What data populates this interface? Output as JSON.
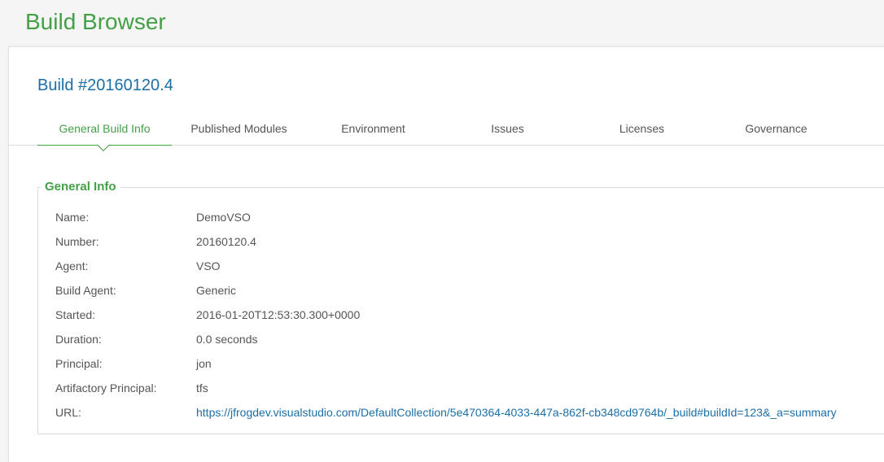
{
  "header": {
    "title": "Build Browser"
  },
  "build": {
    "title": "Build #20160120.4"
  },
  "tabs": [
    {
      "label": "General Build Info",
      "active": true
    },
    {
      "label": "Published Modules",
      "active": false
    },
    {
      "label": "Environment",
      "active": false
    },
    {
      "label": "Issues",
      "active": false
    },
    {
      "label": "Licenses",
      "active": false
    },
    {
      "label": "Governance",
      "active": false
    }
  ],
  "general_info": {
    "legend": "General Info",
    "rows": [
      {
        "label": "Name:",
        "value": "DemoVSO"
      },
      {
        "label": "Number:",
        "value": "20160120.4"
      },
      {
        "label": "Agent:",
        "value": "VSO"
      },
      {
        "label": "Build Agent:",
        "value": "Generic"
      },
      {
        "label": "Started:",
        "value": "2016-01-20T12:53:30.300+0000"
      },
      {
        "label": "Duration:",
        "value": "0.0 seconds"
      },
      {
        "label": "Principal:",
        "value": "jon"
      },
      {
        "label": "Artifactory Principal:",
        "value": "tfs"
      },
      {
        "label": "URL:",
        "value": "https://jfrogdev.visualstudio.com/DefaultCollection/5e470364-4033-447a-862f-cb348cd9764b/_build#buildId=123&_a=summary"
      }
    ]
  },
  "colors": {
    "accent_green": "#43a047",
    "link_blue": "#1b6fa6",
    "text_gray": "#555555"
  }
}
